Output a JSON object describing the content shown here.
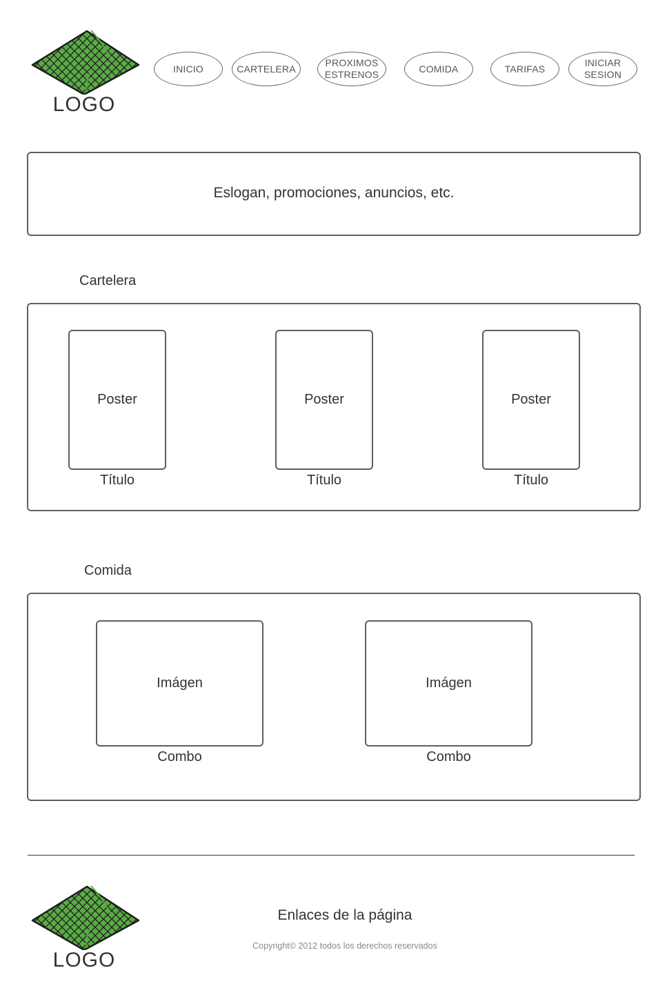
{
  "header": {
    "logo_text": "LOGO",
    "nav": [
      {
        "label": "INICIO"
      },
      {
        "label": "CARTELERA"
      },
      {
        "label": "PROXIMOS\nESTRENOS"
      },
      {
        "label": "COMIDA"
      },
      {
        "label": "TARIFAS"
      },
      {
        "label": "INICIAR\nSESION"
      }
    ]
  },
  "banner": {
    "text": "Eslogan, promociones, anuncios, etc."
  },
  "cartelera": {
    "title": "Cartelera",
    "items": [
      {
        "poster": "Poster",
        "caption": "Título"
      },
      {
        "poster": "Poster",
        "caption": "Título"
      },
      {
        "poster": "Poster",
        "caption": "Título"
      }
    ]
  },
  "comida": {
    "title": "Comida",
    "items": [
      {
        "image": "Imágen",
        "caption": "Combo"
      },
      {
        "image": "Imágen",
        "caption": "Combo"
      }
    ]
  },
  "footer": {
    "logo_text": "LOGO",
    "links": "Enlaces de la página",
    "copyright": "Copyright© 2012 todos los derechos reservados"
  },
  "colors": {
    "logo_fill": "#5aaa46",
    "border": "#5f5f5f",
    "text": "#333333"
  },
  "icons": {
    "logo": "diamond-grid-logo-icon"
  }
}
